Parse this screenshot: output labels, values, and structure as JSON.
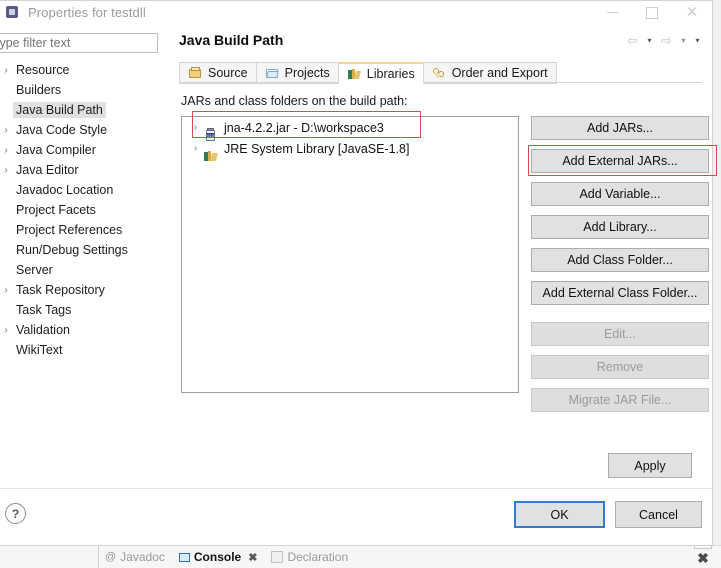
{
  "background": {
    "tabs": [
      {
        "label": "Javadoc",
        "icon": "javadoc-icon",
        "active": false,
        "closeable": false
      },
      {
        "label": "Console",
        "icon": "console-icon",
        "active": true,
        "closeable": true
      },
      {
        "label": "Declaration",
        "icon": "declaration-icon",
        "active": false,
        "closeable": false
      }
    ],
    "close_glyph": "✖"
  },
  "window": {
    "title": "Properties for testdll",
    "icon": "properties-icon",
    "controls": {
      "minimize": "minimize-button",
      "maximize": "maximize-button",
      "close": "✕"
    }
  },
  "sidebar": {
    "filter": {
      "value": "",
      "placeholder": "type filter text"
    },
    "items": [
      {
        "label": "Resource",
        "expandable": true,
        "selected": false
      },
      {
        "label": "Builders",
        "expandable": false,
        "selected": false
      },
      {
        "label": "Java Build Path",
        "expandable": false,
        "selected": true
      },
      {
        "label": "Java Code Style",
        "expandable": true,
        "selected": false
      },
      {
        "label": "Java Compiler",
        "expandable": true,
        "selected": false
      },
      {
        "label": "Java Editor",
        "expandable": true,
        "selected": false
      },
      {
        "label": "Javadoc Location",
        "expandable": false,
        "selected": false
      },
      {
        "label": "Project Facets",
        "expandable": false,
        "selected": false
      },
      {
        "label": "Project References",
        "expandable": false,
        "selected": false
      },
      {
        "label": "Run/Debug Settings",
        "expandable": false,
        "selected": false
      },
      {
        "label": "Server",
        "expandable": false,
        "selected": false
      },
      {
        "label": "Task Repository",
        "expandable": true,
        "selected": false
      },
      {
        "label": "Task Tags",
        "expandable": false,
        "selected": false
      },
      {
        "label": "Validation",
        "expandable": true,
        "selected": false
      },
      {
        "label": "WikiText",
        "expandable": false,
        "selected": false
      }
    ],
    "expand_glyph": "›"
  },
  "page": {
    "title": "Java Build Path",
    "nav": {
      "back": "back-arrow",
      "back_caret": "▾",
      "forward": "forward-arrow",
      "forward_caret": "▾",
      "menu_caret": "▾"
    },
    "tabs": [
      {
        "label": "Source",
        "icon": "source-folder-icon",
        "active": false
      },
      {
        "label": "Projects",
        "icon": "projects-icon",
        "active": false
      },
      {
        "label": "Libraries",
        "icon": "libraries-icon",
        "active": true
      },
      {
        "label": "Order and Export",
        "icon": "order-export-icon",
        "active": false
      }
    ],
    "section_label": "JARs and class folders on the build path:",
    "entries": [
      {
        "label": "jna-4.2.2.jar - D:\\workspace3",
        "icon": "jar-icon",
        "expandable": true
      },
      {
        "label": "JRE System Library [JavaSE-1.8]",
        "icon": "library-icon",
        "expandable": true
      }
    ],
    "entry_expand_glyph": "›",
    "buttons": [
      {
        "label": "Add JARs...",
        "enabled": true,
        "highlighted": false
      },
      {
        "label": "Add External JARs...",
        "enabled": true,
        "highlighted": true
      },
      {
        "label": "Add Variable...",
        "enabled": true,
        "highlighted": false
      },
      {
        "label": "Add Library...",
        "enabled": true,
        "highlighted": false
      },
      {
        "label": "Add Class Folder...",
        "enabled": true,
        "highlighted": false
      },
      {
        "label": "Add External Class Folder...",
        "enabled": true,
        "highlighted": false
      },
      {
        "label": "Edit...",
        "enabled": false,
        "highlighted": false
      },
      {
        "label": "Remove",
        "enabled": false,
        "highlighted": false
      },
      {
        "label": "Migrate JAR File...",
        "enabled": false,
        "highlighted": false
      }
    ],
    "apply_label": "Apply"
  },
  "footer": {
    "help": "?",
    "ok_label": "OK",
    "cancel_label": "Cancel"
  },
  "annotations": {
    "color": "#d94a4a",
    "boxes": [
      {
        "name": "jar-entry-highlight"
      },
      {
        "name": "add-external-jars-highlight"
      }
    ]
  }
}
